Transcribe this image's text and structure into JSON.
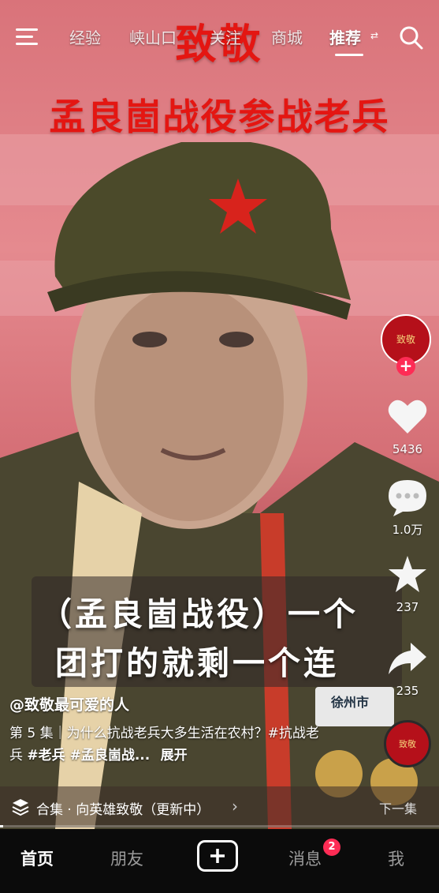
{
  "top_nav": {
    "tabs": [
      {
        "label": "经验"
      },
      {
        "label": "峡山口"
      },
      {
        "label": "关注"
      },
      {
        "label": "商城"
      },
      {
        "label": "推荐"
      }
    ],
    "active_tab": "推荐"
  },
  "video": {
    "title_line1": "致敬",
    "title_line2": "孟良崮战役参战老兵",
    "subtitle_line1": "（孟良崮战役）一个",
    "subtitle_line2": "团打的就剩一个连",
    "badge_text": "徐州市"
  },
  "right_rail": {
    "likes": "5436",
    "comments": "1.0万",
    "favorites": "237",
    "shares": "235"
  },
  "info": {
    "author": "@致敬最可爱的人",
    "desc_prefix": "第 5 集｜为什么抗战老兵大多生活在农村？#抗战老兵 ",
    "tag1": "#老兵",
    "tag2": " #孟良崮战...",
    "expand": "展开"
  },
  "collection": {
    "label": "合集 · 向英雄致敬（更新中）",
    "next": "下一集"
  },
  "tabbar": {
    "home": "首页",
    "friends": "朋友",
    "messages": "消息",
    "messages_badge": "2",
    "me": "我"
  },
  "colors": {
    "title_red": "#e41612",
    "accent": "#fe2c55"
  }
}
